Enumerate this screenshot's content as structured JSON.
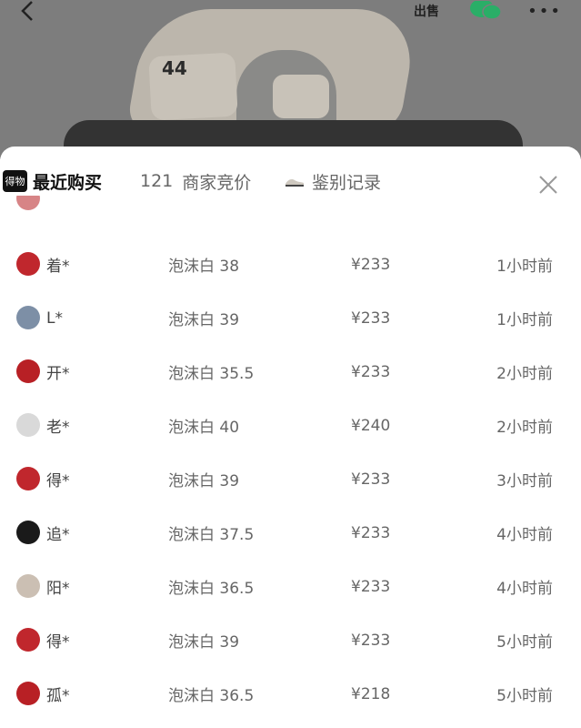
{
  "header": {
    "back_icon": "chevron-left-icon",
    "sell_label": "出售",
    "share_icon": "wechat-icon",
    "more_icon": "more-icon"
  },
  "tabs": {
    "recent": {
      "badge": "得物",
      "label": "最近购买"
    },
    "bids": {
      "count": "121",
      "label": "商家竞价"
    },
    "auth": {
      "label": "鉴别记录",
      "icon": "shoe-icon"
    },
    "close_icon": "close-icon"
  },
  "purchases": [
    {
      "user": "着*",
      "spec": "泡沫白 38",
      "price": "¥233",
      "time": "1小时前",
      "avatar_color": "#c0272d"
    },
    {
      "user": "L*",
      "spec": "泡沫白 39",
      "price": "¥233",
      "time": "1小时前",
      "avatar_color": "#7d8fa6"
    },
    {
      "user": "开*",
      "spec": "泡沫白 35.5",
      "price": "¥233",
      "time": "2小时前",
      "avatar_color": "#b82025"
    },
    {
      "user": "老*",
      "spec": "泡沫白 40",
      "price": "¥240",
      "time": "2小时前",
      "avatar_color": "#d9d9d9"
    },
    {
      "user": "得*",
      "spec": "泡沫白 39",
      "price": "¥233",
      "time": "3小时前",
      "avatar_color": "#c0272d"
    },
    {
      "user": "追*",
      "spec": "泡沫白 37.5",
      "price": "¥233",
      "time": "4小时前",
      "avatar_color": "#1a1a1a"
    },
    {
      "user": "阳*",
      "spec": "泡沫白 36.5",
      "price": "¥233",
      "time": "4小时前",
      "avatar_color": "#cbbfb3"
    },
    {
      "user": "得*",
      "spec": "泡沫白 39",
      "price": "¥233",
      "time": "5小时前",
      "avatar_color": "#c0272d"
    },
    {
      "user": "孤*",
      "spec": "泡沫白 36.5",
      "price": "¥218",
      "time": "5小时前",
      "avatar_color": "#b82025"
    }
  ]
}
